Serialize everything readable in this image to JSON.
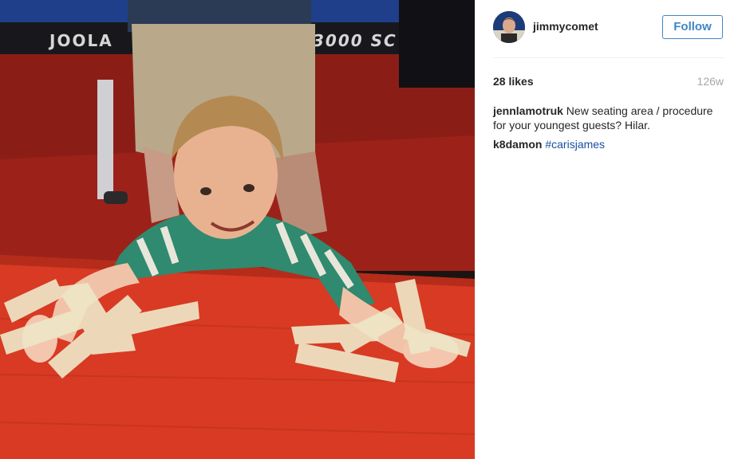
{
  "photo": {
    "table_brand": "JOOLA",
    "table_model": "3000 SC"
  },
  "post": {
    "username": "jimmycomet",
    "follow_label": "Follow",
    "likes": "28 likes",
    "age": "126w",
    "comments": [
      {
        "author": "jennlamotruk",
        "text": "New seating area / procedure for your youngest guests? Hilar.",
        "hashtag": ""
      },
      {
        "author": "k8damon",
        "text": "",
        "hashtag": "#carisjames"
      }
    ]
  },
  "colors": {
    "follow_blue": "#3f87c6",
    "hashtag_blue": "#1a4fa0",
    "table_red": "#d83a24",
    "muted_gray": "#a5a7aa"
  }
}
